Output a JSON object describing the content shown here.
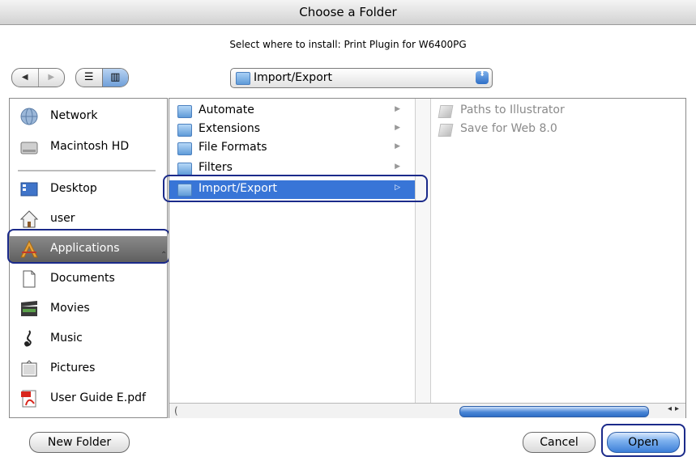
{
  "window": {
    "title": "Choose a Folder"
  },
  "prompt": "Select where to install: Print Plugin for W6400PG",
  "toolbar": {
    "back_glyph": "◀",
    "forward_glyph": "▶",
    "list_view_glyph": "☰",
    "column_view_glyph": "▥"
  },
  "popup": {
    "value": "Import/Export",
    "arrows_glyph": "⬍"
  },
  "sidebar": {
    "items": [
      {
        "label": "Network",
        "icon": "network-icon"
      },
      {
        "label": "Macintosh HD",
        "icon": "hard-drive-icon"
      },
      {
        "label": "Desktop",
        "icon": "desktop-icon"
      },
      {
        "label": "user",
        "icon": "home-icon"
      },
      {
        "label": "Applications",
        "icon": "applications-icon",
        "selected": true
      },
      {
        "label": "Documents",
        "icon": "documents-icon"
      },
      {
        "label": "Movies",
        "icon": "movies-icon"
      },
      {
        "label": "Music",
        "icon": "music-icon"
      },
      {
        "label": "Pictures",
        "icon": "pictures-icon"
      },
      {
        "label": "User Guide E.pdf",
        "icon": "pdf-icon"
      }
    ]
  },
  "column1": {
    "items": [
      {
        "label": "Automate",
        "arrow": "▶"
      },
      {
        "label": "Extensions",
        "arrow": "▶"
      },
      {
        "label": "File Formats",
        "arrow": "▶"
      },
      {
        "label": "Filters",
        "arrow": "▶"
      },
      {
        "label": "Import/Export",
        "arrow": "▷",
        "selected": true
      }
    ]
  },
  "column3": {
    "items": [
      {
        "label": "Paths to Illustrator"
      },
      {
        "label": "Save for Web 8.0"
      }
    ]
  },
  "scrollbar": {
    "left_cap": "(",
    "arrows": "◂▸"
  },
  "buttons": {
    "new_folder": "New Folder",
    "cancel": "Cancel",
    "open": "Open"
  },
  "colors": {
    "selection": "#3875d7",
    "highlight_ring": "#1b2a8a",
    "sidebar_selected": "#6f6f6f"
  }
}
